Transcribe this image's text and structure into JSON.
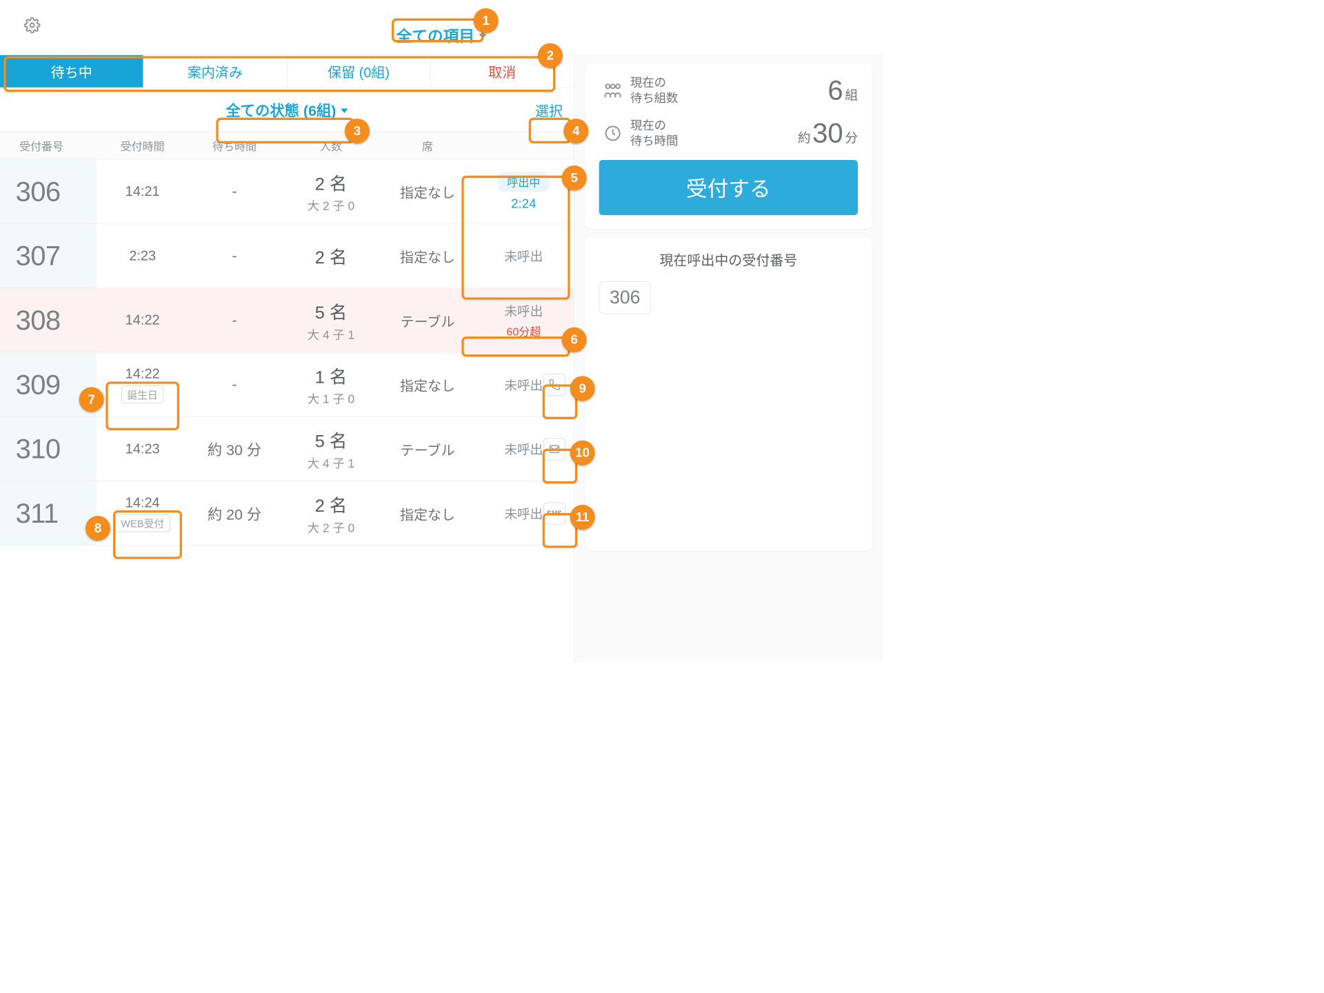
{
  "header": {
    "filter_label": "全ての項目"
  },
  "tabs": [
    {
      "label": "待ち中",
      "active": true
    },
    {
      "label": "案内済み"
    },
    {
      "label": "保留 (0組)"
    },
    {
      "label": "取消"
    }
  ],
  "state_filter": "全ての状態 (6組)",
  "select_label": "選択",
  "columns": {
    "number": "受付番号",
    "time": "受付時間",
    "wait": "待ち時間",
    "party": "人数",
    "seat": "席"
  },
  "rows": [
    {
      "number": "306",
      "time": "14:21",
      "wait": "-",
      "party_main": "2 名",
      "party_sub": "大 2 子 0",
      "seat": "指定なし",
      "status": "calling",
      "status_label": "呼出中",
      "status_time": "2:24"
    },
    {
      "number": "307",
      "time": "2:23",
      "wait": "-",
      "party_main": "2 名",
      "party_sub": "",
      "seat": "指定なし",
      "status": "not",
      "status_label": "未呼出"
    },
    {
      "number": "308",
      "time": "14:22",
      "wait": "-",
      "party_main": "5 名",
      "party_sub": "大 4 子 1",
      "seat": "テーブル",
      "status": "over",
      "status_label": "未呼出",
      "over_label": "60分超",
      "pink": true
    },
    {
      "number": "309",
      "time": "14:22",
      "subtag": "誕生日",
      "wait": "-",
      "party_main": "1 名",
      "party_sub": "大 1 子 0",
      "seat": "指定なし",
      "status": "not",
      "status_label": "未呼出",
      "method": "phone"
    },
    {
      "number": "310",
      "time": "14:23",
      "wait": "約 30 分",
      "party_main": "5 名",
      "party_sub": "大 4 子 1",
      "seat": "テーブル",
      "status": "not",
      "status_label": "未呼出",
      "method": "mail"
    },
    {
      "number": "311",
      "time": "14:24",
      "subtag": "WEB受付",
      "wait": "約 20 分",
      "party_main": "2 名",
      "party_sub": "大 2 子 0",
      "seat": "指定なし",
      "status": "not",
      "status_label": "未呼出",
      "method": "sms"
    }
  ],
  "side": {
    "waiting_label1": "現在の",
    "waiting_label2": "待ち組数",
    "waiting_value": "6",
    "waiting_unit": "組",
    "waittime_label1": "現在の",
    "waittime_label2": "待ち時間",
    "waittime_prefix": "約",
    "waittime_value": "30",
    "waittime_unit": "分",
    "register": "受付する",
    "calling_title": "現在呼出中の受付番号",
    "calling_numbers": [
      "306"
    ]
  },
  "callouts": {
    "1": "1",
    "2": "2",
    "3": "3",
    "4": "4",
    "5": "5",
    "6": "6",
    "7": "7",
    "8": "8",
    "9": "9",
    "10": "10",
    "11": "11"
  }
}
